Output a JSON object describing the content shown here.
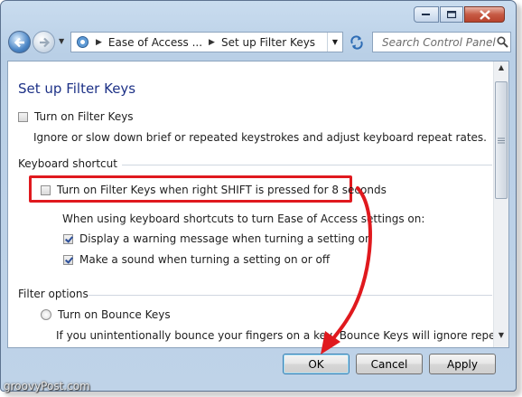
{
  "window": {
    "caption_buttons": [
      "minimize-icon",
      "maximize-icon",
      "close-icon"
    ]
  },
  "navigation": {
    "breadcrumb": [
      "Ease of Access ...",
      "Set up Filter Keys"
    ],
    "search_placeholder": "Search Control Panel"
  },
  "content": {
    "title": "Set up Filter Keys",
    "turn_on_filter_keys": {
      "label": "Turn on Filter Keys",
      "checked": false
    },
    "filter_keys_desc": "Ignore or slow down brief or repeated keystrokes and adjust keyboard repeat rates.",
    "keyboard_shortcut_header": "Keyboard shortcut",
    "shortcut_option": {
      "label": "Turn on Filter Keys when right SHIFT is pressed for 8 seconds",
      "checked": false
    },
    "shortcut_info": "When using keyboard shortcuts to turn Ease of Access settings on:",
    "warning_option": {
      "label": "Display a warning message when turning a setting on",
      "checked": true
    },
    "sound_option": {
      "label": "Make a sound when turning a setting on or off",
      "checked": true
    },
    "filter_options_header": "Filter options",
    "bounce_keys": {
      "label": "Turn on Bounce Keys",
      "selected": false
    },
    "bounce_desc": "If you unintentionally bounce your fingers on a key, Bounce Keys will ignore repeated"
  },
  "footer": {
    "ok_label": "OK",
    "cancel_label": "Cancel",
    "apply_label": "Apply"
  },
  "watermark": "groovyPost.com",
  "colors": {
    "title_blue": "#1e3287",
    "highlight_red": "#e0191e"
  }
}
